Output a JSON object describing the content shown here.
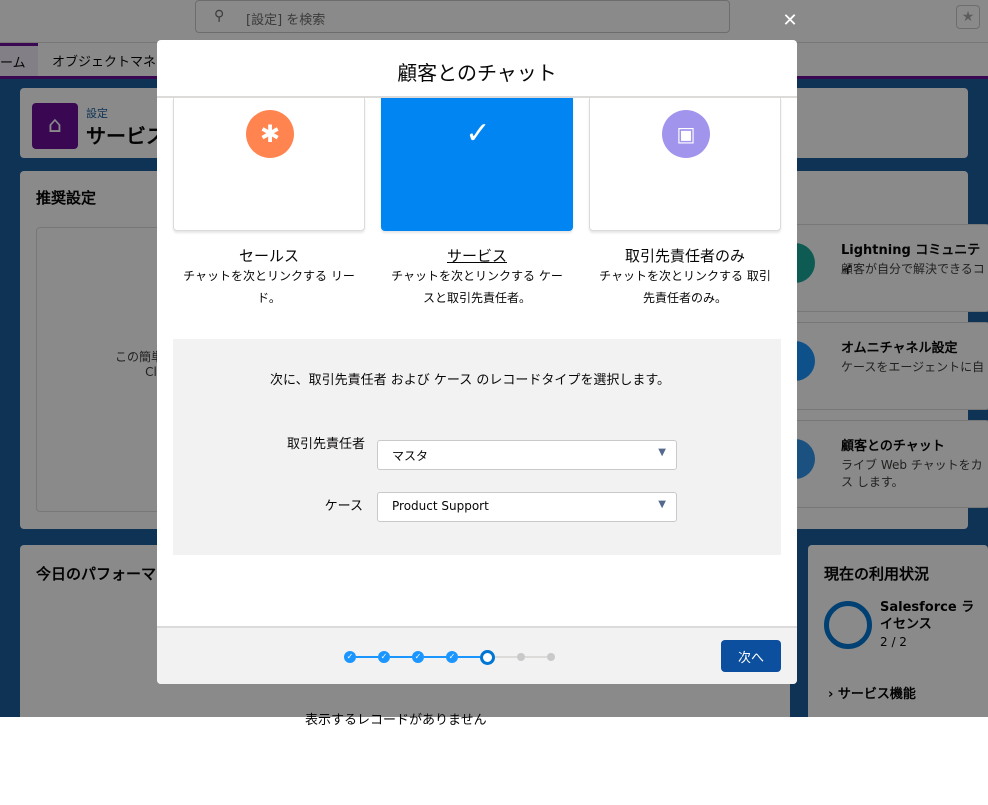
{
  "topbar": {
    "search_placeholder": "[設定] を検索",
    "favorite_icon": "star-icon"
  },
  "nav": {
    "tabs": [
      {
        "label": "ーム"
      },
      {
        "label": "オブジェクトマネ"
      }
    ]
  },
  "page_header": {
    "breadcrumb": "設定",
    "title": "サービス"
  },
  "background": {
    "recommended_title": "推奨設定",
    "recommended_text1": "この簡単な設",
    "recommended_text2": "Cl",
    "tiles": [
      {
        "title": "Lightning コミュニティ",
        "desc": "顧客が自分で解決できるコ"
      },
      {
        "title": "オムニチャネル設定",
        "desc": "ケースをエージェントに自"
      },
      {
        "title": "顧客とのチャット",
        "desc": "ライブ Web チャットをカス します。"
      }
    ],
    "performance_title": "今日のパフォーマ",
    "performance_empty": "表示するレコードがありません",
    "usage_title": "現在の利用状況",
    "usage_license": "Salesforce ライセンス",
    "usage_value": "2 / 2",
    "service_features": "サービス機能"
  },
  "modal": {
    "title": "顧客とのチャット",
    "options": [
      {
        "label": "セールス",
        "desc": "チャットを次とリンクする リード。",
        "icon": "lead-icon",
        "color": "#ff8450",
        "selected": false
      },
      {
        "label": "サービス",
        "desc": "チャットを次とリンクする ケースと取引先責任者。",
        "icon": "check-icon",
        "color": "#0085f2",
        "selected": true
      },
      {
        "label": "取引先責任者のみ",
        "desc": "チャットを次とリンクする 取引先責任者のみ。",
        "icon": "contact-card-icon",
        "color": "#a094ed",
        "selected": false
      }
    ],
    "intro": "次に、取引先責任者 および ケース のレコードタイプを選択します。",
    "fields": [
      {
        "label": "取引先責任者",
        "value": "マスタ"
      },
      {
        "label": "ケース",
        "value": "Product Support"
      }
    ],
    "progress": {
      "total_steps": 7,
      "current_step": 5
    },
    "next_label": "次へ"
  }
}
